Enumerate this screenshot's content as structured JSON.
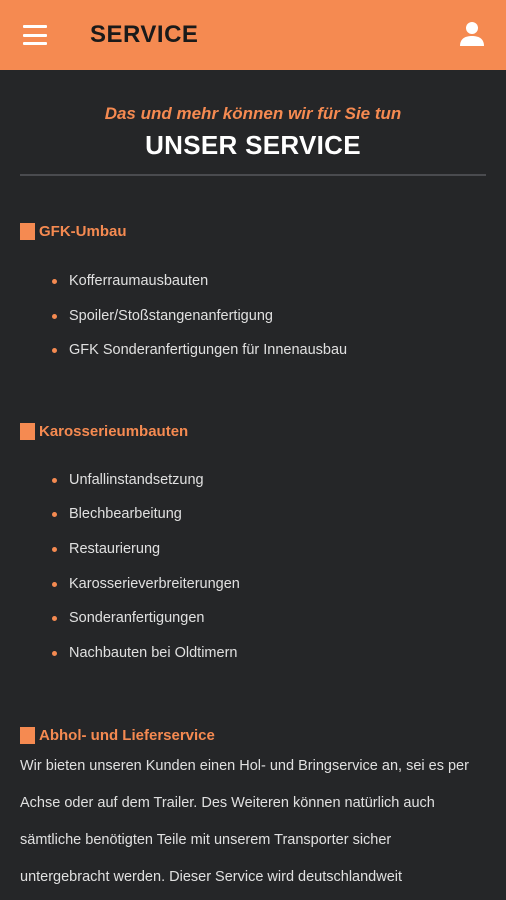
{
  "appbar": {
    "title": "SERVICE"
  },
  "hero": {
    "subtitle": "Das und mehr können wir für Sie tun",
    "title": "UNSER SERVICE"
  },
  "sections": [
    {
      "heading": "GFK-Umbau",
      "items": [
        "Kofferraumausbauten",
        "Spoiler/Stoßstangenanfertigung",
        "GFK Sonderanfertigungen für Innenausbau"
      ]
    },
    {
      "heading": "Karosserieumbauten",
      "items": [
        "Unfallinstandsetzung",
        "Blechbearbeitung",
        "Restaurierung",
        "Karosserieverbreiterungen",
        "Sonderanfertigungen",
        "Nachbauten bei Oldtimern"
      ]
    },
    {
      "heading": "Abhol- und Lieferservice",
      "paragraph_lines": [
        "Wir bieten unseren Kunden einen Hol- und Bringservice an, sei es per",
        "Achse oder auf dem Trailer. Des Weiteren können natürlich auch",
        "sämtliche benötigten Teile mit unserem Transporter sicher",
        "untergebracht werden. Dieser Service wird deutschlandweit"
      ]
    }
  ],
  "colors": {
    "accent": "#f58a51",
    "background": "#252628",
    "appbar_text": "#1a1a1a"
  },
  "icons": {
    "menu": "hamburger-menu-icon",
    "user": "user-icon",
    "bullet": "square-bullet-icon"
  }
}
